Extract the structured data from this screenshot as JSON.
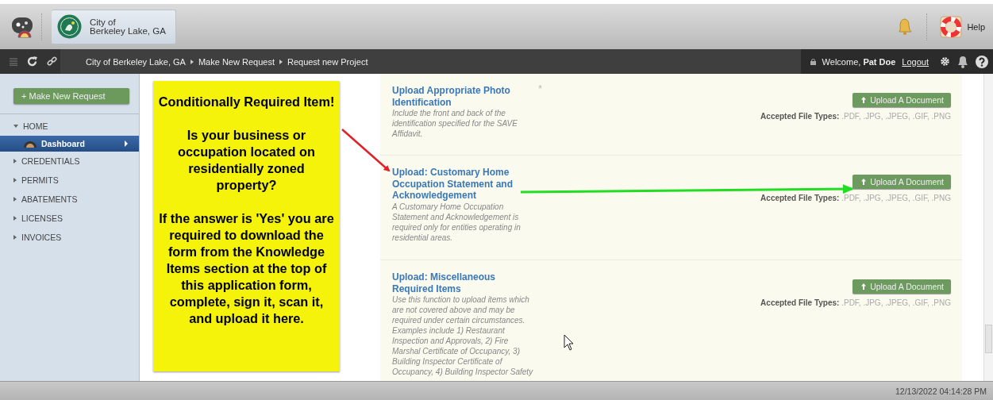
{
  "header": {
    "org_name": "City of\nBerkeley Lake, GA",
    "help": "Help"
  },
  "navbar": {
    "breadcrumb": [
      "City of Berkeley Lake, GA",
      "Make New Request",
      "Request new Project"
    ],
    "welcome": "Welcome, **Pat Doe**",
    "logout": "Logout"
  },
  "sidebar": {
    "new_request": "+ Make New Request",
    "items": [
      {
        "label": "HOME",
        "expanded": true,
        "selected": false,
        "children": [
          {
            "label": "Dashboard",
            "selected": true
          }
        ]
      },
      {
        "label": "CREDENTIALS",
        "expanded": false,
        "selected": false
      },
      {
        "label": "PERMITS",
        "expanded": false,
        "selected": false
      },
      {
        "label": "ABATEMENTS",
        "expanded": false,
        "selected": false
      },
      {
        "label": "LICENSES",
        "expanded": false,
        "selected": false
      },
      {
        "label": "INVOICES",
        "expanded": false,
        "selected": false
      }
    ]
  },
  "note": {
    "paragraphs": [
      "Conditionally Required Item!",
      "Is your business or occupation located on residentially zoned property?",
      "If the answer is 'Yes' you are required to download the form from the Knowledge Items section at the top of this application form, complete, sign it, scan it, and upload it here."
    ]
  },
  "uploads": [
    {
      "title": "Upload Appropriate Photo Identification",
      "required_mark": "*",
      "description": "Include the front and back of the identification specified for the SAVE Affidavit.",
      "button": "Upload A Document",
      "types_label": "Accepted File Types:",
      "types": ".PDF, .JPG, .JPEG, .GIF, .PNG"
    },
    {
      "title": "Upload: Customary Home Occupation Statement and Acknowledgement",
      "description": "A Customary Home Occupation Statement and Acknowledgement is required only for entities operating in residential areas.",
      "button": "Upload A Document",
      "types_label": "Accepted File Types:",
      "types": ".PDF, .JPG, .JPEG, .GIF, .PNG"
    },
    {
      "title": "Upload: Miscellaneous Required Items",
      "description": "Use this function to upload items which are not covered above and may be required under certain circumstances. Examples include 1) Restaurant Inspection and Approvals, 2) Fire Marshal Certificate of Occupancy, 3) Building Inspector Certificate of Occupancy, 4) Building Inspector Safety",
      "button": "Upload A Document",
      "types_label": "Accepted File Types:",
      "types": ".PDF, .JPG, .JPEG, .GIF, .PNG"
    }
  ],
  "status_bar": {
    "timestamp": "12/13/2022 04:14:28 PM"
  }
}
